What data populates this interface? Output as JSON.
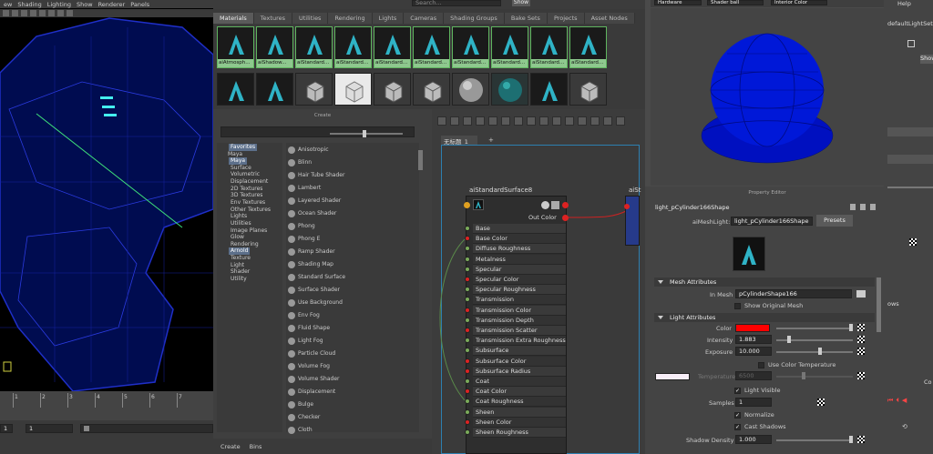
{
  "viewport": {
    "menu": [
      "ew",
      "Shading",
      "Lighting",
      "Show",
      "Renderer",
      "Panels"
    ],
    "timeline_ticks": [
      "1",
      "2",
      "3",
      "4",
      "5",
      "6",
      "7"
    ],
    "frame_start": "1",
    "frame_current": "1"
  },
  "hypershade": {
    "search_placeholder": "Search...",
    "show_label": "Show",
    "tabs": [
      "Materials",
      "Textures",
      "Utilities",
      "Rendering",
      "Lights",
      "Cameras",
      "Shading Groups",
      "Bake Sets",
      "Projects",
      "Asset Nodes"
    ],
    "swatch_labels": [
      "aiAtmosph...",
      "aiShadow...",
      "aiStandard...",
      "aiStandard...",
      "aiStandard...",
      "aiStandard...",
      "aiStandard...",
      "aiStandard...",
      "aiStandard...",
      "aiStandard..."
    ]
  },
  "create": {
    "title": "Create",
    "tree": [
      {
        "label": "Favorites",
        "hl": true
      },
      {
        "label": "Maya",
        "hl": false
      },
      {
        "label": "Maya",
        "hl": true
      },
      {
        "label": "Surface",
        "hl": false
      },
      {
        "label": "Volumetric",
        "hl": false
      },
      {
        "label": "Displacement",
        "hl": false
      },
      {
        "label": "2D Textures",
        "hl": false
      },
      {
        "label": "3D Textures",
        "hl": false
      },
      {
        "label": "Env Textures",
        "hl": false
      },
      {
        "label": "Other Textures",
        "hl": false
      },
      {
        "label": "Lights",
        "hl": false
      },
      {
        "label": "Utilities",
        "hl": false
      },
      {
        "label": "Image Planes",
        "hl": false
      },
      {
        "label": "Glow",
        "hl": false
      },
      {
        "label": "Rendering",
        "hl": false
      },
      {
        "label": "Arnold",
        "hl": true
      },
      {
        "label": "Texture",
        "hl": false
      },
      {
        "label": "Light",
        "hl": false
      },
      {
        "label": "Shader",
        "hl": false
      },
      {
        "label": "Utility",
        "hl": false
      }
    ],
    "list": [
      "Anisotropic",
      "Blinn",
      "Hair Tube Shader",
      "Lambert",
      "Layered Shader",
      "Ocean Shader",
      "Phong",
      "Phong E",
      "Ramp Shader",
      "Shading Map",
      "Standard Surface",
      "Surface Shader",
      "Use Background",
      "Env Fog",
      "Fluid Shape",
      "Light Fog",
      "Particle Cloud",
      "Volume Fog",
      "Volume Shader",
      "Displacement",
      "Bulge",
      "Checker",
      "Cloth"
    ],
    "footer_tabs": [
      "Create",
      "Bins"
    ]
  },
  "graph": {
    "tab": "无标题_1",
    "add_tab": "+",
    "node_title": "aiStandardSurface8",
    "node_title2": "aiSt",
    "out_label": "Out Color",
    "attributes": [
      "Base",
      "Base Color",
      "Diffuse Roughness",
      "Metalness",
      "Specular",
      "Specular Color",
      "Specular Roughness",
      "Transmission",
      "Transmission Color",
      "Transmission Depth",
      "Transmission Scatter",
      "Transmission Extra Roughness",
      "Subsurface",
      "Subsurface Color",
      "Subsurface Radius",
      "Coat",
      "Coat Color",
      "Coat Roughness",
      "Sheen",
      "Sheen Color",
      "Sheen Roughness"
    ]
  },
  "render_view": {
    "renderer": "Hardware",
    "shader_ball": "Shader ball",
    "color_mode": "Interior Color"
  },
  "property_editor": {
    "title": "Property Editor",
    "node_name": "light_pCylinder166Shape",
    "type_label": "aiMeshLight:",
    "type_value": "light_pCylinder166Shape",
    "presets": "Presets",
    "mesh_section": "Mesh Attributes",
    "in_mesh_label": "In Mesh",
    "in_mesh_value": "pCylinderShape166",
    "show_original_mesh": "Show Original Mesh",
    "light_section": "Light Attributes",
    "color_label": "Color",
    "color_value": "#ff0000",
    "intensity_label": "Intensity",
    "intensity_value": "1.883",
    "exposure_label": "Exposure",
    "exposure_value": "10.000",
    "use_color_temp": "Use Color Temperature",
    "temperature_label": "Temperature",
    "temperature_value": "6500",
    "light_visible": "Light Visible",
    "samples_label": "Samples",
    "samples_value": "1",
    "normalize": "Normalize",
    "cast_shadows": "Cast Shadows",
    "shadow_density_label": "Shadow Density",
    "shadow_density_value": "1.000"
  },
  "right_panel": {
    "help": "Help",
    "light_set": "defaultLightSet",
    "ows": "ows",
    "co": "Co",
    "show": "Show"
  }
}
